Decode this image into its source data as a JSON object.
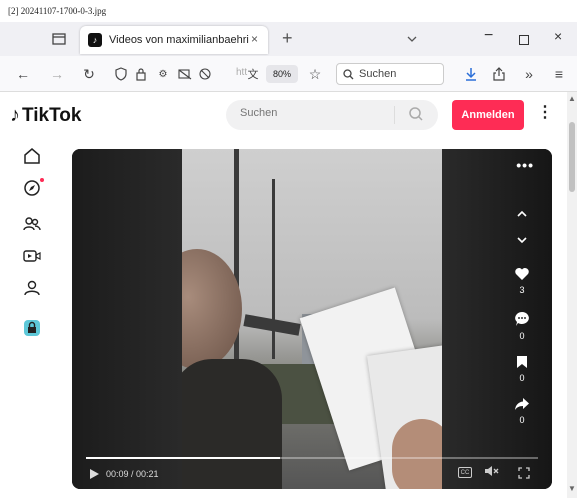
{
  "caption": "[2] 20241107-1700-0-3.jpg",
  "browser": {
    "tab_title": "Videos von maximilianbaehring",
    "tab_close": "×",
    "new_tab": "+",
    "window_minimize": "−",
    "window_close": "×",
    "url_fragment": "htt",
    "zoom": "80%",
    "search_label": "Suchen"
  },
  "tiktok": {
    "logo_text": "TikTok",
    "search_placeholder": "Suchen",
    "login_label": "Anmelden",
    "more_label": "⋮"
  },
  "video": {
    "time": "00:09 / 00:21",
    "progress": 0.43,
    "likes": "3",
    "comments": "0",
    "saves": "0",
    "shares": "0",
    "more_label": "•••",
    "cc_label": "CC"
  },
  "colors": {
    "accent": "#fe2c55",
    "tab_strip": "#f0f0f4",
    "nav_bar": "#f9f9fb",
    "download": "#2a6ed8"
  }
}
